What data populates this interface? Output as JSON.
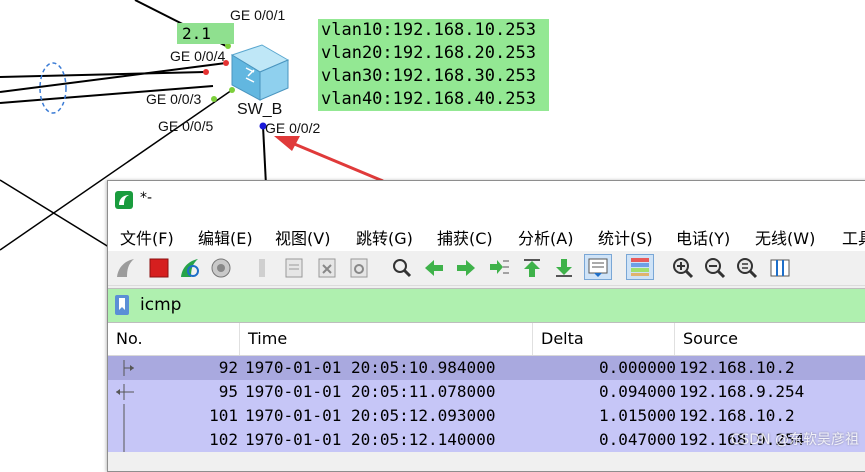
{
  "topology": {
    "badge": "2.1",
    "ports": {
      "ge001": "GE 0/0/1",
      "ge004": "GE 0/0/4",
      "ge003": "GE 0/0/3",
      "ge005": "GE 0/0/5",
      "ge002": "GE 0/0/2"
    },
    "switch_name": "SW_B",
    "vlans": [
      "vlan10:192.168.10.253",
      "vlan20:192.168.20.253",
      "vlan30:192.168.30.253",
      "vlan40:192.168.40.253"
    ],
    "colors": {
      "vlan_box": "#93e893",
      "arrow": "#e03a3a",
      "link_line": "#000000"
    }
  },
  "wireshark": {
    "title": "*-",
    "menu": [
      "文件(F)",
      "编辑(E)",
      "视图(V)",
      "跳转(G)",
      "捕获(C)",
      "分析(A)",
      "统计(S)",
      "电话(Y)",
      "无线(W)",
      "工具"
    ],
    "toolbar_icons": [
      "shark-fin-icon",
      "stop-capture-icon",
      "restart-capture-icon",
      "capture-options-icon",
      "open-file-icon",
      "save-file-icon",
      "close-file-icon",
      "reload-icon",
      "find-icon",
      "go-back-icon",
      "go-forward-icon",
      "go-to-packet-icon",
      "first-packet-icon",
      "last-packet-icon",
      "autoscroll-icon",
      "colorize-icon",
      "zoom-in-icon",
      "zoom-out-icon",
      "normal-size-icon",
      "resize-columns-icon"
    ],
    "filter": {
      "value": "icmp",
      "color": "#aff0af"
    },
    "columns": [
      "No.",
      "Time",
      "Delta",
      "Source"
    ],
    "rows": [
      {
        "no": "92",
        "time": "1970-01-01 20:05:10.984000",
        "delta": "0.000000",
        "source": "192.168.10.2",
        "selected": true,
        "mark": "request"
      },
      {
        "no": "95",
        "time": "1970-01-01 20:05:11.078000",
        "delta": "0.094000",
        "source": "192.168.9.254",
        "selected": false,
        "mark": "reply"
      },
      {
        "no": "101",
        "time": "1970-01-01 20:05:12.093000",
        "delta": "1.015000",
        "source": "192.168.10.2",
        "selected": false,
        "mark": "none"
      },
      {
        "no": "102",
        "time": "1970-01-01 20:05:12.140000",
        "delta": "0.047000",
        "source": "192.168.9.254",
        "selected": false,
        "mark": "none"
      }
    ],
    "row_colors": {
      "selected": "#a9a9df",
      "normal": "#c6c6f7"
    }
  },
  "watermark": "CSDN @东软吴彦祖"
}
